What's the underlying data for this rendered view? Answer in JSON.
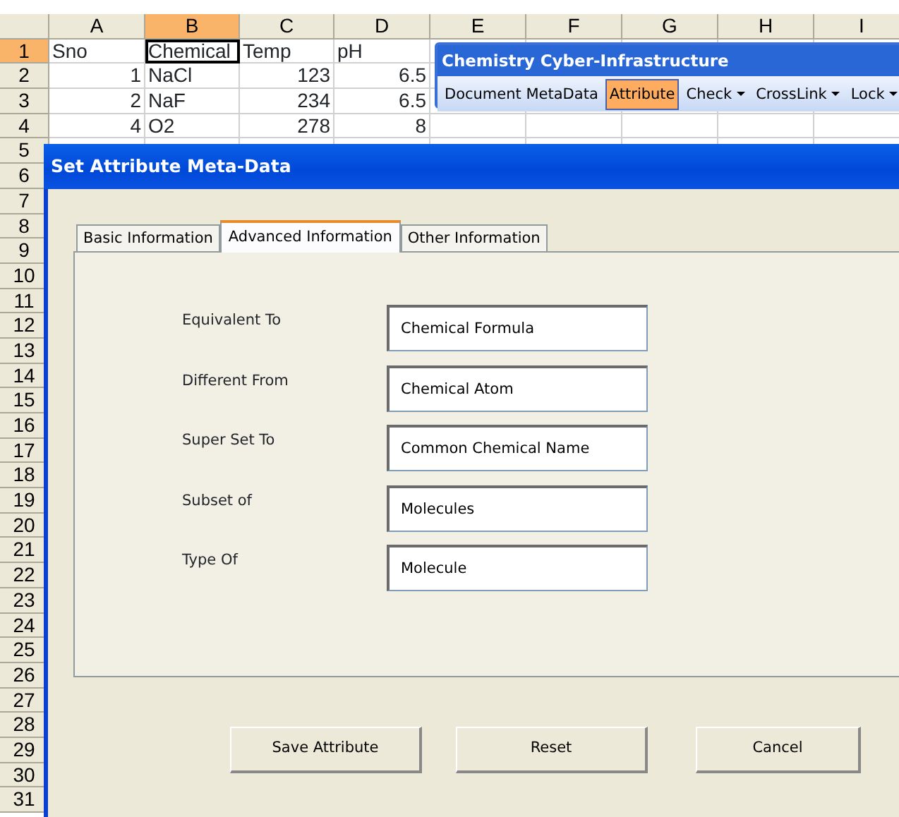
{
  "sheet": {
    "columns": [
      {
        "label": "A",
        "selected": false
      },
      {
        "label": "B",
        "selected": true
      },
      {
        "label": "C",
        "selected": false
      },
      {
        "label": "D",
        "selected": false
      },
      {
        "label": "E",
        "selected": false
      },
      {
        "label": "F",
        "selected": false
      },
      {
        "label": "G",
        "selected": false
      },
      {
        "label": "H",
        "selected": false
      },
      {
        "label": "I",
        "selected": false
      }
    ],
    "row_headers": [
      {
        "label": "1",
        "selected": true
      },
      {
        "label": "2",
        "selected": false
      },
      {
        "label": "3",
        "selected": false
      },
      {
        "label": "4",
        "selected": false
      },
      {
        "label": "5",
        "selected": false
      },
      {
        "label": "6",
        "selected": false
      },
      {
        "label": "7",
        "selected": false
      },
      {
        "label": "8",
        "selected": false
      },
      {
        "label": "9",
        "selected": false
      },
      {
        "label": "10",
        "selected": false
      },
      {
        "label": "11",
        "selected": false
      },
      {
        "label": "12",
        "selected": false
      },
      {
        "label": "13",
        "selected": false
      },
      {
        "label": "14",
        "selected": false
      },
      {
        "label": "15",
        "selected": false
      },
      {
        "label": "16",
        "selected": false
      },
      {
        "label": "17",
        "selected": false
      },
      {
        "label": "18",
        "selected": false
      },
      {
        "label": "19",
        "selected": false
      },
      {
        "label": "20",
        "selected": false
      },
      {
        "label": "21",
        "selected": false
      },
      {
        "label": "22",
        "selected": false
      },
      {
        "label": "23",
        "selected": false
      },
      {
        "label": "24",
        "selected": false
      },
      {
        "label": "25",
        "selected": false
      },
      {
        "label": "26",
        "selected": false
      },
      {
        "label": "27",
        "selected": false
      },
      {
        "label": "28",
        "selected": false
      },
      {
        "label": "29",
        "selected": false
      },
      {
        "label": "30",
        "selected": false
      },
      {
        "label": "31",
        "selected": false
      }
    ],
    "rows": [
      [
        {
          "text": "Sno",
          "kind": "text",
          "active": false
        },
        {
          "text": "Chemical",
          "kind": "text",
          "active": true
        },
        {
          "text": "Temp",
          "kind": "text",
          "active": false
        },
        {
          "text": "pH",
          "kind": "text",
          "active": false
        }
      ],
      [
        {
          "text": "1",
          "kind": "number",
          "active": false
        },
        {
          "text": "NaCl",
          "kind": "text",
          "active": false
        },
        {
          "text": "123",
          "kind": "number",
          "active": false
        },
        {
          "text": "6.5",
          "kind": "number",
          "active": false
        }
      ],
      [
        {
          "text": "2",
          "kind": "number",
          "active": false
        },
        {
          "text": "NaF",
          "kind": "text",
          "active": false
        },
        {
          "text": "234",
          "kind": "number",
          "active": false
        },
        {
          "text": "6.5",
          "kind": "number",
          "active": false
        }
      ],
      [
        {
          "text": "4",
          "kind": "number",
          "active": false
        },
        {
          "text": "O2",
          "kind": "text",
          "active": false
        },
        {
          "text": "278",
          "kind": "number",
          "active": false
        },
        {
          "text": "8",
          "kind": "number",
          "active": false
        }
      ]
    ]
  },
  "toolbar": {
    "title": "Chemistry Cyber-Infrastructure",
    "items": [
      {
        "label": "Document MetaData",
        "selected": false,
        "dropdown": false
      },
      {
        "label": "Attribute",
        "selected": true,
        "dropdown": false
      },
      {
        "label": "Check",
        "selected": false,
        "dropdown": true
      },
      {
        "label": "CrossLink",
        "selected": false,
        "dropdown": true
      },
      {
        "label": "Lock",
        "selected": false,
        "dropdown": true
      }
    ]
  },
  "dialog": {
    "title": "Set Attribute Meta-Data",
    "tabs": [
      {
        "label": "Basic Information",
        "selected": false
      },
      {
        "label": "Advanced Information",
        "selected": true
      },
      {
        "label": "Other Information",
        "selected": false
      }
    ],
    "fields": [
      {
        "label": "Equivalent To",
        "value": "Chemical Formula"
      },
      {
        "label": "Different From",
        "value": "Chemical Atom"
      },
      {
        "label": "Super Set To",
        "value": "Common Chemical Name"
      },
      {
        "label": "Subset of",
        "value": "Molecules"
      },
      {
        "label": "Type Of",
        "value": "Molecule"
      }
    ],
    "buttons": [
      "Save Attribute",
      "Reset",
      "Cancel"
    ]
  }
}
